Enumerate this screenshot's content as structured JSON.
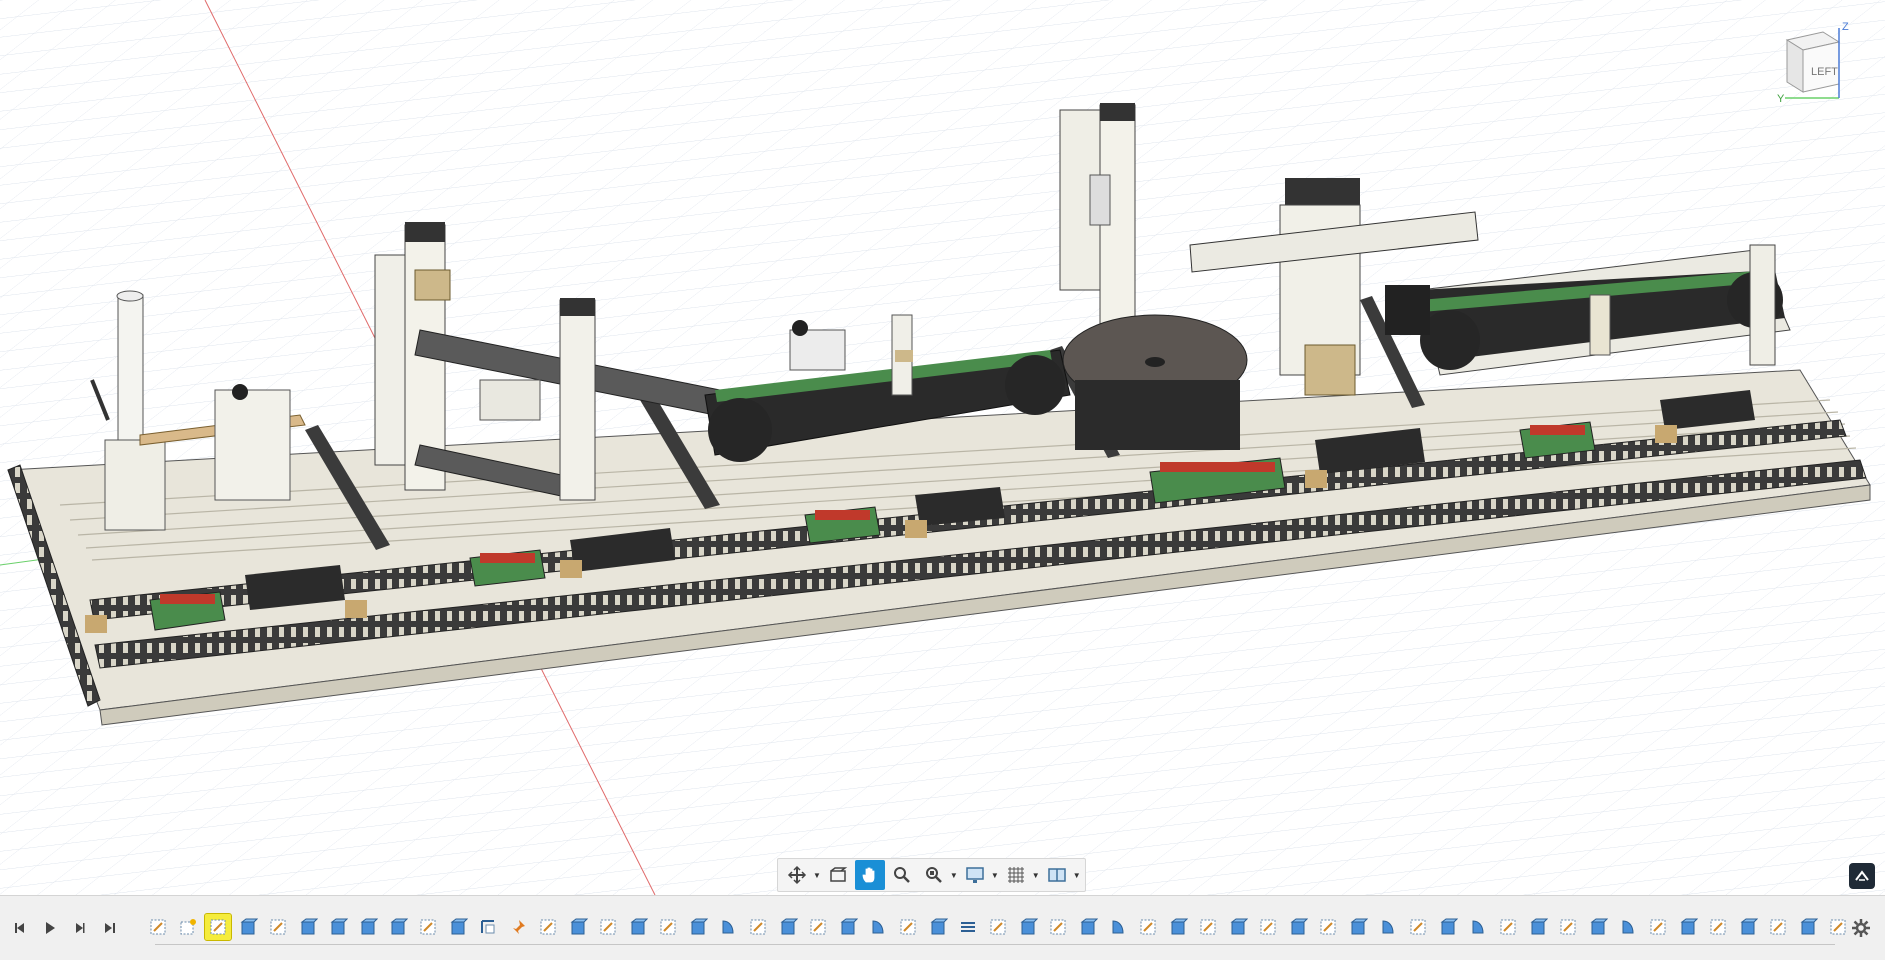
{
  "viewcube": {
    "face_label": "LEFT",
    "axis_z": "Z",
    "axis_y": "Y"
  },
  "nav_toolbar": {
    "tools": [
      {
        "icon": "orbit-icon",
        "has_menu": true
      },
      {
        "icon": "look-at-icon",
        "has_menu": false
      },
      {
        "icon": "pan-hand-icon",
        "has_menu": false,
        "active": true
      },
      {
        "icon": "zoom-icon",
        "has_menu": false
      },
      {
        "icon": "fit-icon",
        "has_menu": true
      },
      {
        "icon": "display-settings-icon",
        "has_menu": true
      },
      {
        "icon": "grid-snaps-icon",
        "has_menu": true
      },
      {
        "icon": "viewports-icon",
        "has_menu": true
      }
    ]
  },
  "timeline": {
    "playback": [
      "skip-to-start-icon",
      "step-back-icon",
      "play-icon",
      "step-forward-icon",
      "skip-to-end-icon"
    ],
    "features": [
      "sketch",
      "sketch-star",
      "sketch",
      "component",
      "sketch",
      "component",
      "component",
      "component",
      "component",
      "sketch",
      "component",
      "corner-sketch",
      "pin",
      "sketch",
      "component",
      "sketch",
      "component",
      "sketch",
      "component",
      "revolve",
      "sketch",
      "component",
      "sketch",
      "component",
      "revolve",
      "sketch",
      "component",
      "pattern",
      "sketch",
      "component",
      "sketch",
      "component",
      "revolve",
      "sketch",
      "component",
      "sketch",
      "component",
      "sketch",
      "component",
      "sketch",
      "component",
      "revolve",
      "sketch",
      "component",
      "revolve",
      "sketch",
      "component",
      "sketch",
      "component",
      "revolve",
      "sketch",
      "component",
      "sketch",
      "component",
      "sketch",
      "component",
      "sketch"
    ],
    "selected_index": 2
  },
  "colors": {
    "grid_line": "#dde3ec",
    "x_axis": "#e06a6a",
    "y_axis": "#6ad06a",
    "frame_light": "#e4e2d6",
    "frame_dark": "#3d3d3d",
    "belt_green": "#4a8c4c",
    "brass": "#c8a870",
    "terminal_red": "#c0392b",
    "accent_blue": "#1a8fd6",
    "selected_yellow": "#f5ec3c"
  }
}
